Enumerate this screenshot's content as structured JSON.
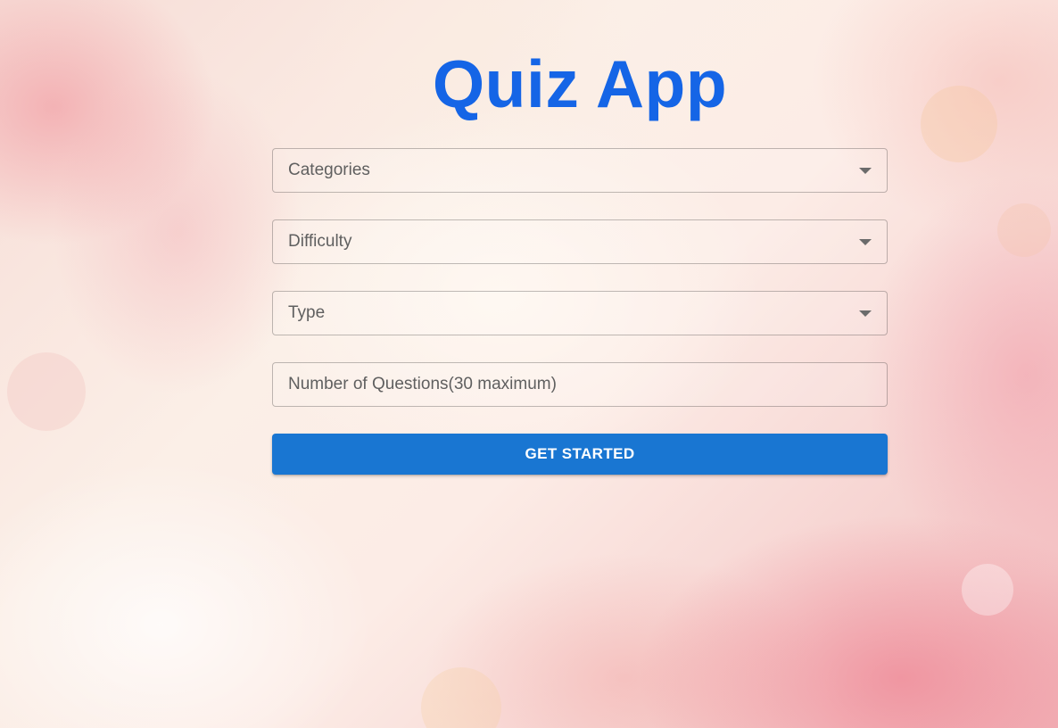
{
  "app": {
    "title": "Quiz App",
    "accent_color": "#1565e6"
  },
  "form": {
    "categories_label": "Categories",
    "difficulty_label": "Difficulty",
    "type_label": "Type",
    "questions_placeholder": "Number of Questions(30 maximum)",
    "questions_value": "",
    "submit_label": "GET STARTED",
    "submit_color": "#1976d2",
    "dropdown_icon": "caret-down-icon"
  }
}
